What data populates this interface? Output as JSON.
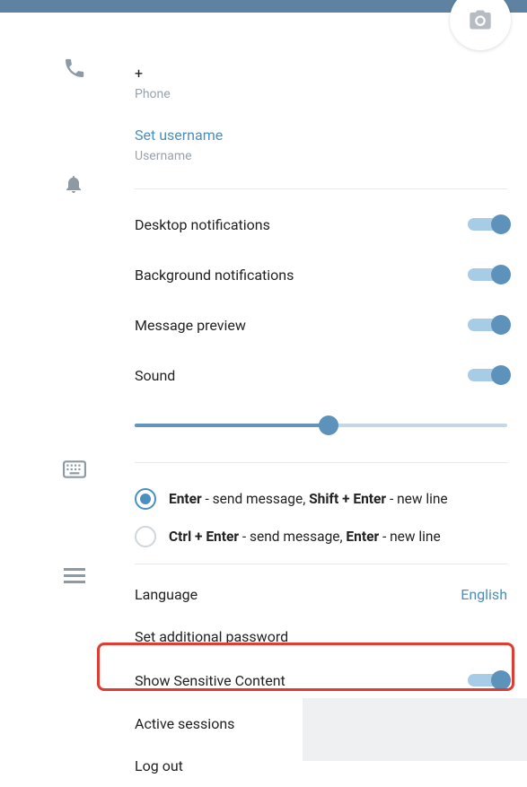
{
  "profile": {
    "phone_value": "+",
    "phone_label": "Phone",
    "set_username": "Set username",
    "username_label": "Username"
  },
  "notifications": {
    "desktop": "Desktop notifications",
    "background": "Background notifications",
    "preview": "Message preview",
    "sound": "Sound"
  },
  "sendKeys": {
    "option1": {
      "k1": "Enter",
      "t1": " - send message, ",
      "k2": "Shift + Enter",
      "t2": " - new line"
    },
    "option2": {
      "k1": "Ctrl + Enter",
      "t1": " - send message, ",
      "k2": "Enter",
      "t2": " - new line"
    }
  },
  "general": {
    "language_label": "Language",
    "language_value": "English",
    "additional_password": "Set additional password",
    "sensitive_content": "Show Sensitive Content",
    "active_sessions": "Active sessions",
    "logout": "Log out"
  }
}
